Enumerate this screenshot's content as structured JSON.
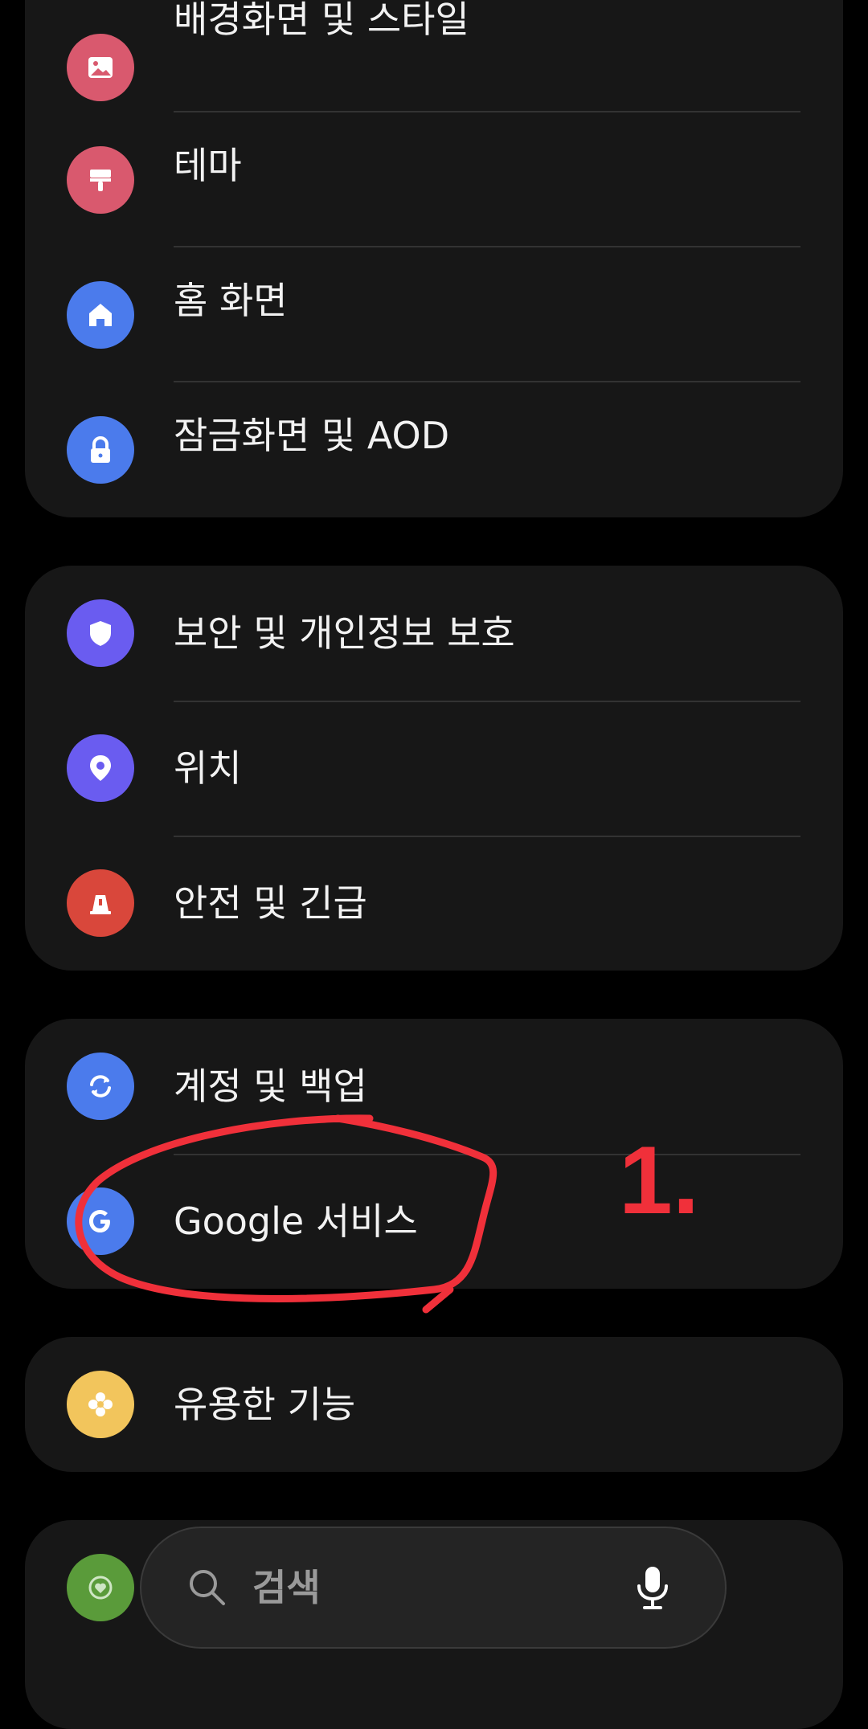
{
  "groups": [
    {
      "items": [
        {
          "label": "배경화면 및 스타일",
          "icon": "wallpaper-icon",
          "color": "#D9596E"
        },
        {
          "label": "테마",
          "icon": "theme-brush-icon",
          "color": "#D9596E"
        },
        {
          "label": "홈 화면",
          "icon": "home-icon",
          "color": "#4B7BEC"
        },
        {
          "label": "잠금화면 및 AOD",
          "icon": "lock-icon",
          "color": "#4B7BEC"
        }
      ]
    },
    {
      "items": [
        {
          "label": "보안 및 개인정보 보호",
          "icon": "shield-icon",
          "color": "#6A5CF0"
        },
        {
          "label": "위치",
          "icon": "location-pin-icon",
          "color": "#6A5CF0"
        },
        {
          "label": "안전 및 긴급",
          "icon": "emergency-icon",
          "color": "#D9473B"
        }
      ]
    },
    {
      "items": [
        {
          "label": "계정 및 백업",
          "icon": "sync-icon",
          "color": "#4B7BEC"
        },
        {
          "label": "Google 서비스",
          "icon": "google-icon",
          "color": "#4B7BEC"
        }
      ]
    },
    {
      "items": [
        {
          "label": "유용한 기능",
          "icon": "advanced-features-icon",
          "color": "#F2C55C"
        }
      ]
    }
  ],
  "search": {
    "placeholder": "검색",
    "icon": "search-icon",
    "mic_icon": "microphone-icon"
  },
  "partial_item": {
    "icon": "digital-wellbeing-icon",
    "color": "#5A9B3A"
  },
  "annotation": {
    "text": "1.",
    "color": "#F0303A"
  }
}
